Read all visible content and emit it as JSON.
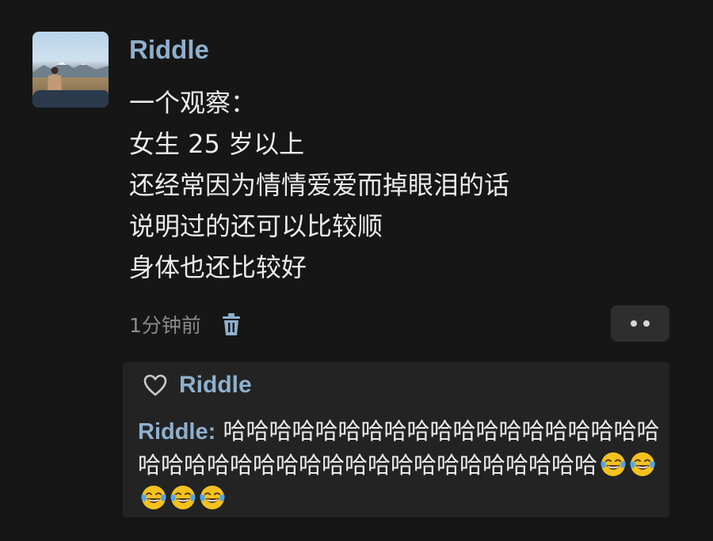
{
  "post": {
    "author": "Riddle",
    "lines": [
      "一个观察：",
      "女生 25 岁以上",
      "还经常因为情情爱爱而掉眼泪的话",
      "说明过的还可以比较顺",
      "身体也还比较好"
    ],
    "time": "1分钟前"
  },
  "icons": {
    "delete": "trash-icon",
    "more": "more-dots-icon",
    "like": "heart-icon",
    "emoji": "face-with-tears-of-joy"
  },
  "reply": {
    "liked_by": "Riddle",
    "comment_author": "Riddle:",
    "comment_text": " 哈哈哈哈哈哈哈哈哈哈哈哈哈哈哈哈哈哈哈哈哈哈哈哈哈哈哈哈哈哈哈哈哈哈哈哈哈哈哈",
    "emoji_count": 5
  },
  "colors": {
    "background": "#161616",
    "username": "#8fb0cd",
    "text": "#ececec",
    "muted": "#8a8a8a",
    "reply_panel": "#232323",
    "button": "#2e2e2e"
  }
}
